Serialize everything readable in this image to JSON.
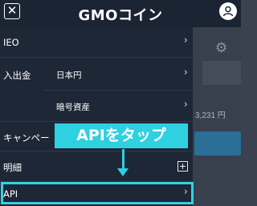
{
  "header": {
    "close_glyph": "✕",
    "logo_text": "GMOコイン",
    "user_icon": "user-circle-icon"
  },
  "menu": {
    "items": [
      {
        "label": "IEO",
        "chevron": "›"
      },
      {
        "label": "入出金",
        "subitems": [
          {
            "label": "日本円",
            "chevron": "›"
          },
          {
            "label": "暗号資産",
            "chevron": "›"
          }
        ]
      },
      {
        "label": "キャンペー",
        "chevron": "›"
      },
      {
        "label": "明細",
        "expand": "+"
      },
      {
        "label": "API",
        "chevron": "›"
      }
    ]
  },
  "background": {
    "amount_text": "3,231 円"
  },
  "annotation": {
    "callout_text": "APIをタップ",
    "color": "#2fd0e0"
  }
}
